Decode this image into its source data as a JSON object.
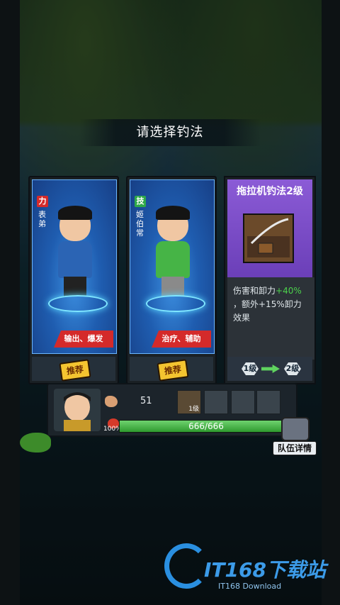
{
  "prompt_title": "请选择钓法",
  "cards": [
    {
      "tag": "力",
      "tag_color": "#d42a2a",
      "name": "表弟",
      "roles": "输出、爆发",
      "badge": "推荐",
      "shirt_color": "#2b64b4"
    },
    {
      "tag": "技",
      "tag_color": "#2ea84a",
      "name": "姬伯常",
      "roles": "治疗、辅助",
      "badge": "推荐",
      "shirt_color": "#46b446"
    }
  ],
  "skill": {
    "title": "拖拉机钓法2级",
    "desc_line1_prefix": "伤害和卸力",
    "desc_line1_bonus": "+40%",
    "desc_line2": "，额外+15%卸力",
    "desc_line3": "效果",
    "from_level": "1级",
    "to_level": "2级"
  },
  "team": {
    "power": "51",
    "slot_level": "1级",
    "hp": "666/666",
    "hp_percent": "100%",
    "hp_fill": 1.0
  },
  "team_details_label": "队伍详情",
  "watermark": {
    "title": "IT168下载站",
    "subtitle": "IT168 Download"
  }
}
